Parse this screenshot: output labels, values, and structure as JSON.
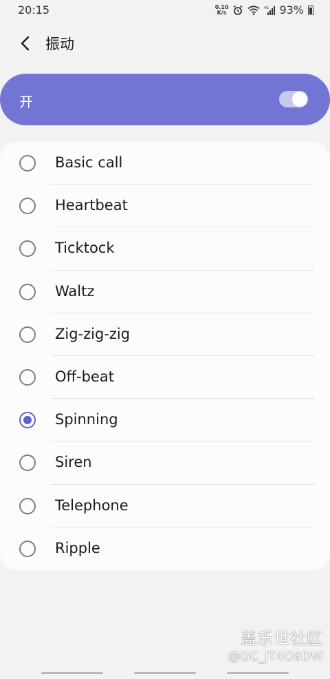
{
  "status_bar": {
    "time": "20:15",
    "net_speed_value": "0.10",
    "net_speed_unit": "K/s",
    "battery": "93%",
    "icons": [
      "alarm-icon",
      "wifi-icon",
      "signal-icon",
      "battery-icon"
    ]
  },
  "header": {
    "title": "振动",
    "back_icon": "chevron-left-icon"
  },
  "master_switch": {
    "label": "开",
    "state": true,
    "accent_color": "#7275d3"
  },
  "patterns": {
    "selected": "Spinning",
    "items": [
      {
        "label": "Basic call",
        "checked": false
      },
      {
        "label": "Heartbeat",
        "checked": false
      },
      {
        "label": "Ticktock",
        "checked": false
      },
      {
        "label": "Waltz",
        "checked": false
      },
      {
        "label": "Zig-zig-zig",
        "checked": false
      },
      {
        "label": "Off-beat",
        "checked": false
      },
      {
        "label": "Spinning",
        "checked": true
      },
      {
        "label": "Siren",
        "checked": false
      },
      {
        "label": "Telephone",
        "checked": false
      },
      {
        "label": "Ripple",
        "checked": false
      }
    ]
  },
  "watermark": {
    "logo": "盖乐世社区",
    "user": "@GC_JT4O8DW"
  }
}
